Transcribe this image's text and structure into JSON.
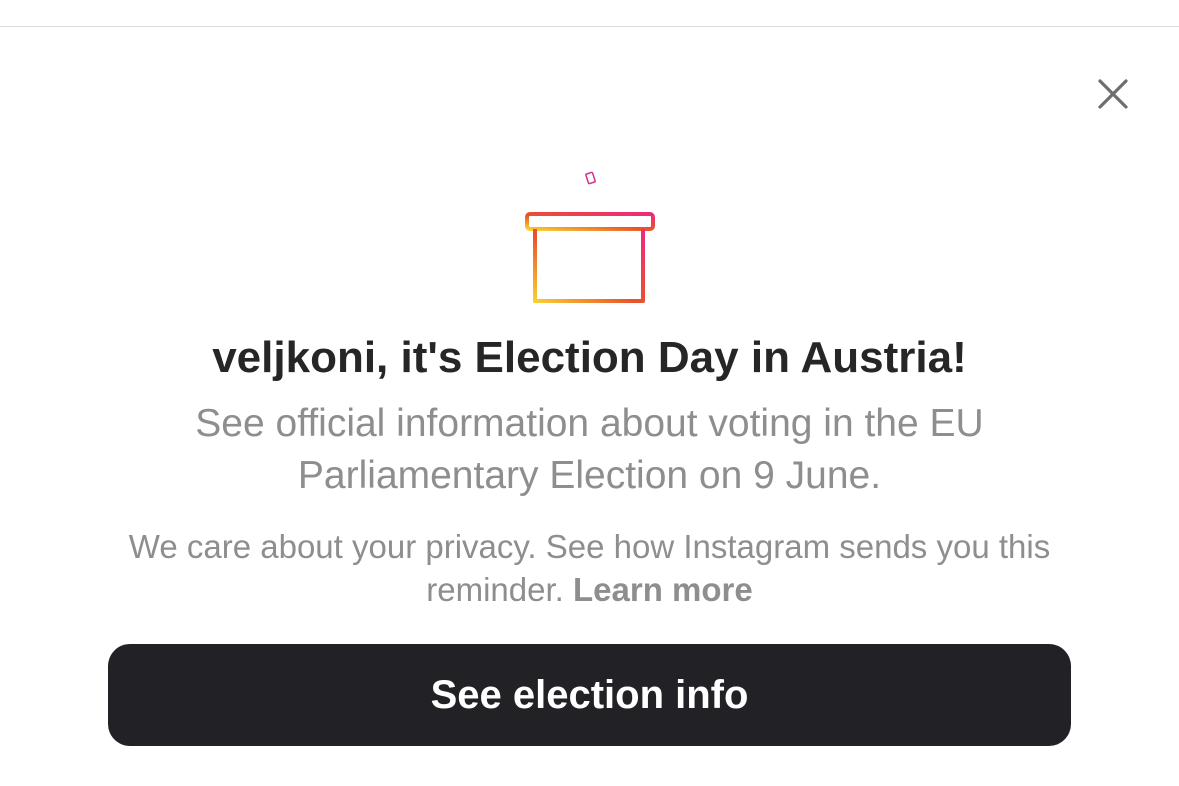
{
  "dialog": {
    "title": "veljkoni, it's Election Day in Austria!",
    "subtitle": "See official information about voting in the EU Parliamentary Election on 9 June.",
    "privacy_text": "We care about your privacy. See how Instagram sends you this reminder.",
    "learn_more_label": "Learn more",
    "cta_label": "See election info",
    "close_icon": "close-icon",
    "ballot_icon": "ballot-box-icon"
  },
  "colors": {
    "background": "#ffffff",
    "title_text": "#262626",
    "secondary_text": "#8e8e8e",
    "button_background": "#222226",
    "button_text": "#ffffff",
    "gradient_start": "#f9ce34",
    "gradient_mid": "#ee2a7b",
    "gradient_end": "#e8542a"
  }
}
